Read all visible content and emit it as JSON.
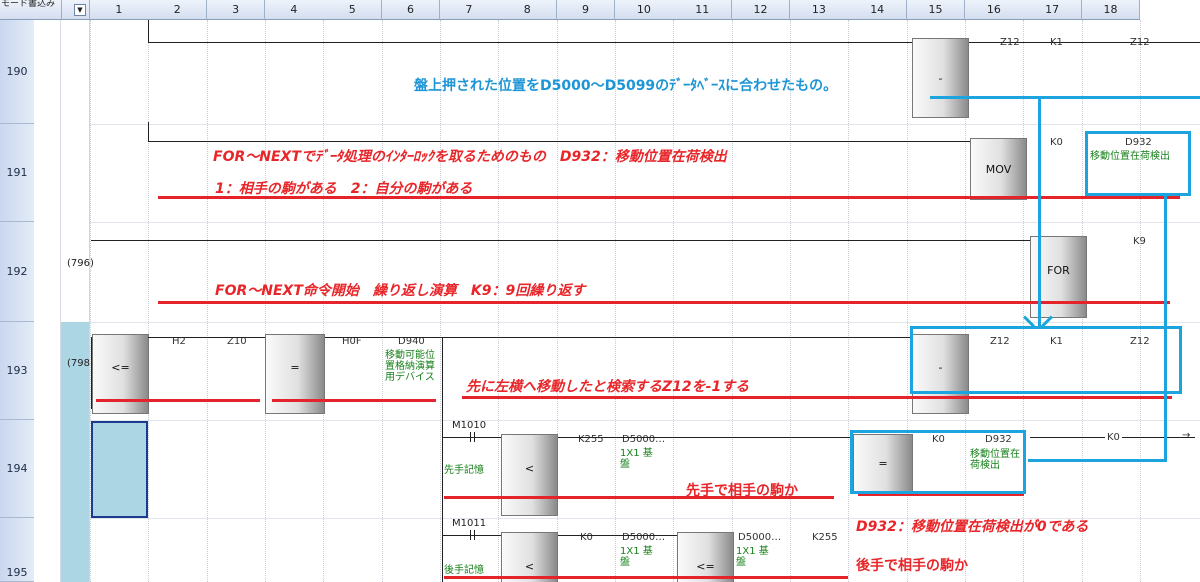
{
  "header": {
    "first_col": "モード書込み",
    "columns": [
      "1",
      "2",
      "3",
      "4",
      "5",
      "6",
      "7",
      "8",
      "9",
      "10",
      "11",
      "12",
      "13",
      "14",
      "15",
      "16",
      "17",
      "18"
    ]
  },
  "rows": [
    {
      "num": "190",
      "step": ""
    },
    {
      "num": "191",
      "step": ""
    },
    {
      "num": "192",
      "step": "(796)"
    },
    {
      "num": "193",
      "step": "(798)"
    },
    {
      "num": "194",
      "step": ""
    },
    {
      "num": "195",
      "step": ""
    }
  ],
  "r190": {
    "inst": "-",
    "op1": "Z12",
    "op2": "K1",
    "op3": "Z12"
  },
  "r191": {
    "inst": "MOV",
    "op1": "K0",
    "op2": "D932",
    "op2_comment": "移動位置在荷検出"
  },
  "r192": {
    "inst": "FOR",
    "op1": "K9"
  },
  "r193": {
    "cmp1": {
      "inst": "<=",
      "op1": "H2",
      "op2": "Z10"
    },
    "cmp2": {
      "inst": "=",
      "op1": "H0F",
      "op2": "D940",
      "comment": "移動可能位置格納演算用デバイス"
    },
    "sub": {
      "inst": "-",
      "op1": "Z12",
      "op2": "K1",
      "op3": "Z12"
    }
  },
  "r194": {
    "contact": "M1010",
    "contact_comment": "先手記憶",
    "cmp1": {
      "inst": "<",
      "op1": "K255",
      "op2": "D5000…",
      "comment": "1X1 基盤"
    },
    "cmp2": {
      "inst": "=",
      "op1": "K0",
      "op2": "D932",
      "comment": "移動位置在荷検出"
    },
    "coil": "K0"
  },
  "r195": {
    "contact": "M1011",
    "contact_comment": "後手記憶",
    "cmp1": {
      "inst": "<",
      "op1": "K0",
      "op2": "D5000…",
      "comment": "1X1 基盤"
    },
    "cmp2": {
      "inst": "<=",
      "op1": "D5000…",
      "op2": "K255",
      "comment": "1X1 基盤"
    }
  },
  "annotations": {
    "a190": "盤上押された位置をD5000〜D5099のﾃﾞｰﾀﾍﾞｰｽに合わせたもの。",
    "a191a": "FOR〜NEXTでﾃﾞｰﾀ処理のｲﾝﾀｰﾛｯｸを取るためのもの　D932：移動位置在荷検出",
    "a191b": "1：相手の駒がある　2：自分の駒がある",
    "a192": "FOR〜NEXT命令開始　繰り返し演算　K9：9回繰り返す",
    "a193": "先に左横へ移動したと検索するZ12を-1する",
    "a194": "先手で相手の駒か",
    "a194b": "D932：移動位置在荷検出が0である",
    "a195": "後手で相手の駒か"
  },
  "colors": {
    "annotation_red": "#e8262a",
    "annotation_blue": "#1e95d6",
    "operand_green": "#17811b",
    "selection": "#acd6e4"
  }
}
